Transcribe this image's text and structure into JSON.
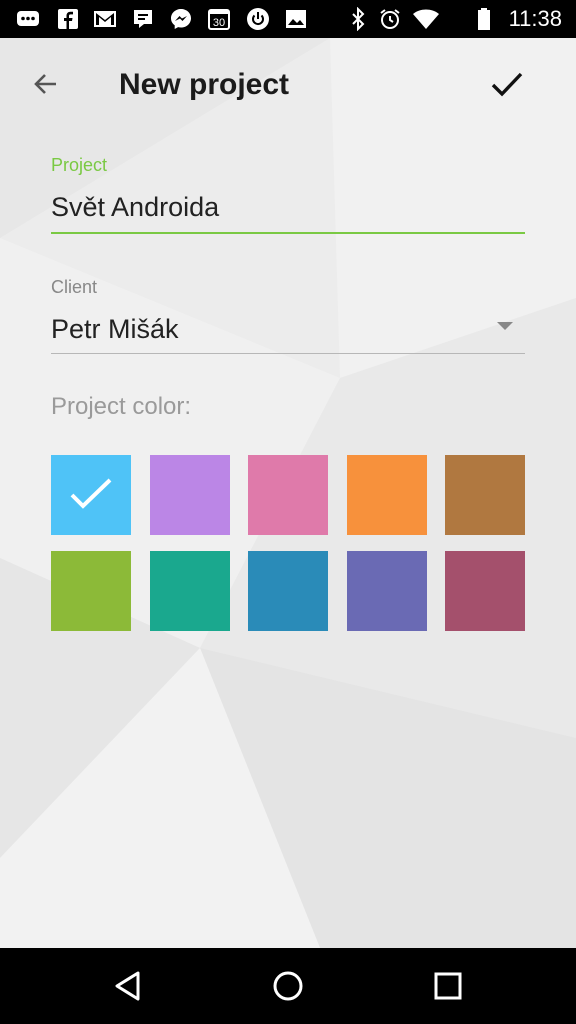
{
  "status_bar": {
    "time": "11:38",
    "icons": [
      "chat-bubbles-icon",
      "facebook-icon",
      "gmail-icon",
      "hangouts-icon",
      "messenger-icon",
      "calendar-30-icon",
      "power-icon",
      "image-icon",
      "bluetooth-icon",
      "alarm-icon",
      "wifi-icon",
      "battery-icon"
    ]
  },
  "toolbar": {
    "title": "New project",
    "back_icon": "arrow-back-icon",
    "done_icon": "checkmark-icon"
  },
  "form": {
    "project_label": "Project",
    "project_value": "Svět Androida",
    "client_label": "Client",
    "client_value": "Petr Mišák",
    "color_label": "Project color:"
  },
  "colors": {
    "accent": "#7ac943",
    "swatches": [
      "#4fc3f7",
      "#bb86e6",
      "#df7aaa",
      "#f7913c",
      "#b07840",
      "#8cba38",
      "#1aa88e",
      "#2a8bb8",
      "#6a6ab4",
      "#a4506c"
    ],
    "selected_index": 0
  },
  "nav_bar": {
    "icons": [
      "back-triangle-icon",
      "home-circle-icon",
      "recents-square-icon"
    ]
  }
}
